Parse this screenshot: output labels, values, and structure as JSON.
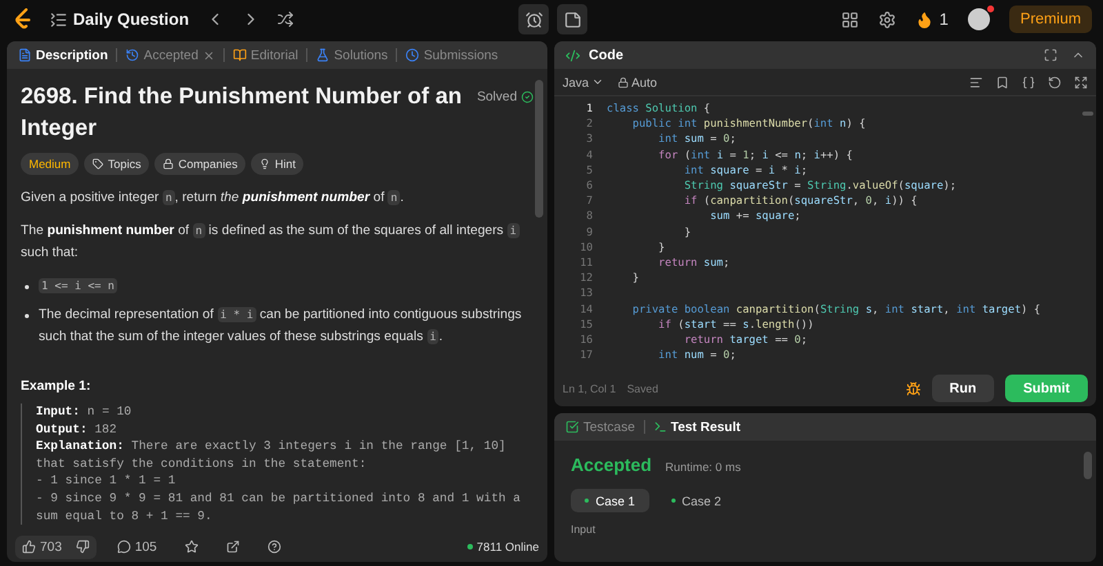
{
  "topbar": {
    "title": "Daily Question",
    "streak": "1",
    "premium": "Premium"
  },
  "description_panel": {
    "tabs": [
      {
        "label": "Description",
        "selected": true,
        "closable": false
      },
      {
        "label": "Accepted",
        "selected": false,
        "closable": true
      },
      {
        "label": "Editorial",
        "selected": false,
        "closable": false
      },
      {
        "label": "Solutions",
        "selected": false,
        "closable": false
      },
      {
        "label": "Submissions",
        "selected": false,
        "closable": false
      }
    ],
    "title": "2698. Find the Punishment Number of an Integer",
    "status": "Solved",
    "difficulty": "Medium",
    "tags": [
      "Topics",
      "Companies",
      "Hint"
    ],
    "paragraphs": [
      [
        {
          "kind": "plain",
          "text": "Given a positive integer "
        },
        {
          "kind": "code",
          "text": "n"
        },
        {
          "kind": "plain",
          "text": ", return "
        },
        {
          "kind": "italic",
          "text": "the "
        },
        {
          "kind": "bolditalic",
          "text": "punishment number"
        },
        {
          "kind": "plain",
          "text": " of "
        },
        {
          "kind": "code",
          "text": "n"
        },
        {
          "kind": "plain",
          "text": "."
        }
      ],
      [
        {
          "kind": "plain",
          "text": "The "
        },
        {
          "kind": "bold",
          "text": "punishment number"
        },
        {
          "kind": "plain",
          "text": " of "
        },
        {
          "kind": "code",
          "text": "n"
        },
        {
          "kind": "plain",
          "text": " is defined as the sum of the squares of all integers "
        },
        {
          "kind": "code",
          "text": "i"
        },
        {
          "kind": "plain",
          "text": " such that:"
        }
      ]
    ],
    "bullets": [
      [
        {
          "kind": "code",
          "text": "1 <= i <= n"
        }
      ],
      [
        {
          "kind": "plain",
          "text": "The decimal representation of "
        },
        {
          "kind": "code",
          "text": "i * i"
        },
        {
          "kind": "plain",
          "text": " can be partitioned into contiguous substrings such that the sum of the integer values of these substrings equals "
        },
        {
          "kind": "code",
          "text": "i"
        },
        {
          "kind": "plain",
          "text": "."
        }
      ]
    ],
    "example": {
      "title": "Example 1:",
      "lines": [
        {
          "label": "Input:",
          "text": "n = 10"
        },
        {
          "label": "Output:",
          "text": "182"
        },
        {
          "label": "Explanation:",
          "text": "There are exactly 3 integers i in the range [1, 10]"
        },
        {
          "text": "that satisfy the conditions in the statement:"
        },
        {
          "text": "- 1 since 1 * 1 = 1"
        },
        {
          "text": "- 9 since 9 * 9 = 81 and 81 can be partitioned into 8 and 1 with a"
        },
        {
          "text": "sum equal to 8 + 1 == 9."
        }
      ]
    },
    "footer": {
      "likes": "703",
      "comments": "105",
      "online": "7811 Online"
    }
  },
  "code_panel": {
    "title": "Code",
    "language": "Java",
    "mode": "Auto",
    "status": "Ln 1, Col 1",
    "saved": "Saved",
    "run": "Run",
    "submit": "Submit",
    "lines": [
      {
        "number": "1",
        "tokens": [
          {
            "kind": "keyword",
            "text": "class "
          },
          {
            "kind": "type",
            "text": "Solution"
          },
          {
            "kind": "plain",
            "text": " {"
          }
        ]
      },
      {
        "number": "2",
        "tokens": [
          {
            "kind": "keyword",
            "text": "    public "
          },
          {
            "kind": "keyword",
            "text": "int "
          },
          {
            "kind": "function",
            "text": "punishmentNumber"
          },
          {
            "kind": "plain",
            "text": "("
          },
          {
            "kind": "keyword",
            "text": "int "
          },
          {
            "kind": "variable",
            "text": "n"
          },
          {
            "kind": "plain",
            "text": ") {"
          }
        ]
      },
      {
        "number": "3",
        "tokens": [
          {
            "kind": "keyword",
            "text": "        int "
          },
          {
            "kind": "variable",
            "text": "sum"
          },
          {
            "kind": "plain",
            "text": " = "
          },
          {
            "kind": "number",
            "text": "0"
          },
          {
            "kind": "plain",
            "text": ";"
          }
        ]
      },
      {
        "number": "4",
        "tokens": [
          {
            "kind": "control",
            "text": "        for"
          },
          {
            "kind": "plain",
            "text": " ("
          },
          {
            "kind": "keyword",
            "text": "int "
          },
          {
            "kind": "variable",
            "text": "i"
          },
          {
            "kind": "plain",
            "text": " = "
          },
          {
            "kind": "number",
            "text": "1"
          },
          {
            "kind": "plain",
            "text": "; "
          },
          {
            "kind": "variable",
            "text": "i"
          },
          {
            "kind": "plain",
            "text": " <= "
          },
          {
            "kind": "variable",
            "text": "n"
          },
          {
            "kind": "plain",
            "text": "; "
          },
          {
            "kind": "variable",
            "text": "i"
          },
          {
            "kind": "plain",
            "text": "++) {"
          }
        ]
      },
      {
        "number": "5",
        "tokens": [
          {
            "kind": "keyword",
            "text": "            int "
          },
          {
            "kind": "variable",
            "text": "square"
          },
          {
            "kind": "plain",
            "text": " = "
          },
          {
            "kind": "variable",
            "text": "i"
          },
          {
            "kind": "plain",
            "text": " * "
          },
          {
            "kind": "variable",
            "text": "i"
          },
          {
            "kind": "plain",
            "text": ";"
          }
        ]
      },
      {
        "number": "6",
        "tokens": [
          {
            "kind": "type",
            "text": "            String "
          },
          {
            "kind": "variable",
            "text": "squareStr"
          },
          {
            "kind": "plain",
            "text": " = "
          },
          {
            "kind": "type",
            "text": "String"
          },
          {
            "kind": "plain",
            "text": "."
          },
          {
            "kind": "function",
            "text": "valueOf"
          },
          {
            "kind": "plain",
            "text": "("
          },
          {
            "kind": "variable",
            "text": "square"
          },
          {
            "kind": "plain",
            "text": ");"
          }
        ]
      },
      {
        "number": "7",
        "tokens": [
          {
            "kind": "control",
            "text": "            if"
          },
          {
            "kind": "plain",
            "text": " ("
          },
          {
            "kind": "function",
            "text": "canpartition"
          },
          {
            "kind": "plain",
            "text": "("
          },
          {
            "kind": "variable",
            "text": "squareStr"
          },
          {
            "kind": "plain",
            "text": ", "
          },
          {
            "kind": "number",
            "text": "0"
          },
          {
            "kind": "plain",
            "text": ", "
          },
          {
            "kind": "variable",
            "text": "i"
          },
          {
            "kind": "plain",
            "text": ")) {"
          }
        ]
      },
      {
        "number": "8",
        "tokens": [
          {
            "kind": "variable",
            "text": "                sum"
          },
          {
            "kind": "plain",
            "text": " += "
          },
          {
            "kind": "variable",
            "text": "square"
          },
          {
            "kind": "plain",
            "text": ";"
          }
        ]
      },
      {
        "number": "9",
        "tokens": [
          {
            "kind": "plain",
            "text": "            }"
          }
        ]
      },
      {
        "number": "10",
        "tokens": [
          {
            "kind": "plain",
            "text": "        }"
          }
        ]
      },
      {
        "number": "11",
        "tokens": [
          {
            "kind": "control",
            "text": "        return "
          },
          {
            "kind": "variable",
            "text": "sum"
          },
          {
            "kind": "plain",
            "text": ";"
          }
        ]
      },
      {
        "number": "12",
        "tokens": [
          {
            "kind": "plain",
            "text": "    }"
          }
        ]
      },
      {
        "number": "13"
      },
      {
        "number": "14",
        "tokens": [
          {
            "kind": "keyword",
            "text": "    private "
          },
          {
            "kind": "keyword",
            "text": "boolean "
          },
          {
            "kind": "function",
            "text": "canpartition"
          },
          {
            "kind": "plain",
            "text": "("
          },
          {
            "kind": "type",
            "text": "String "
          },
          {
            "kind": "variable",
            "text": "s"
          },
          {
            "kind": "plain",
            "text": ", "
          },
          {
            "kind": "keyword",
            "text": "int "
          },
          {
            "kind": "variable",
            "text": "start"
          },
          {
            "kind": "plain",
            "text": ", "
          },
          {
            "kind": "keyword",
            "text": "int "
          },
          {
            "kind": "variable",
            "text": "target"
          },
          {
            "kind": "plain",
            "text": ") {"
          }
        ]
      },
      {
        "number": "15",
        "tokens": [
          {
            "kind": "control",
            "text": "        if"
          },
          {
            "kind": "plain",
            "text": " ("
          },
          {
            "kind": "variable",
            "text": "start"
          },
          {
            "kind": "plain",
            "text": " == "
          },
          {
            "kind": "variable",
            "text": "s"
          },
          {
            "kind": "plain",
            "text": "."
          },
          {
            "kind": "function",
            "text": "length"
          },
          {
            "kind": "plain",
            "text": "())"
          }
        ]
      },
      {
        "number": "16",
        "tokens": [
          {
            "kind": "control",
            "text": "            return "
          },
          {
            "kind": "variable",
            "text": "target"
          },
          {
            "kind": "plain",
            "text": " == "
          },
          {
            "kind": "number",
            "text": "0"
          },
          {
            "kind": "plain",
            "text": ";"
          }
        ]
      },
      {
        "number": "17",
        "tokens": [
          {
            "kind": "keyword",
            "text": "        int "
          },
          {
            "kind": "variable",
            "text": "num"
          },
          {
            "kind": "plain",
            "text": " = "
          },
          {
            "kind": "number",
            "text": "0"
          },
          {
            "kind": "plain",
            "text": ";"
          }
        ]
      }
    ]
  },
  "result_panel": {
    "tabs": [
      {
        "label": "Testcase",
        "selected": false
      },
      {
        "label": "Test Result",
        "selected": true
      }
    ],
    "status": "Accepted",
    "runtime": "Runtime: 0 ms",
    "cases": [
      {
        "label": "Case 1",
        "selected": true
      },
      {
        "label": "Case 2",
        "selected": false
      }
    ],
    "input_label": "Input"
  }
}
